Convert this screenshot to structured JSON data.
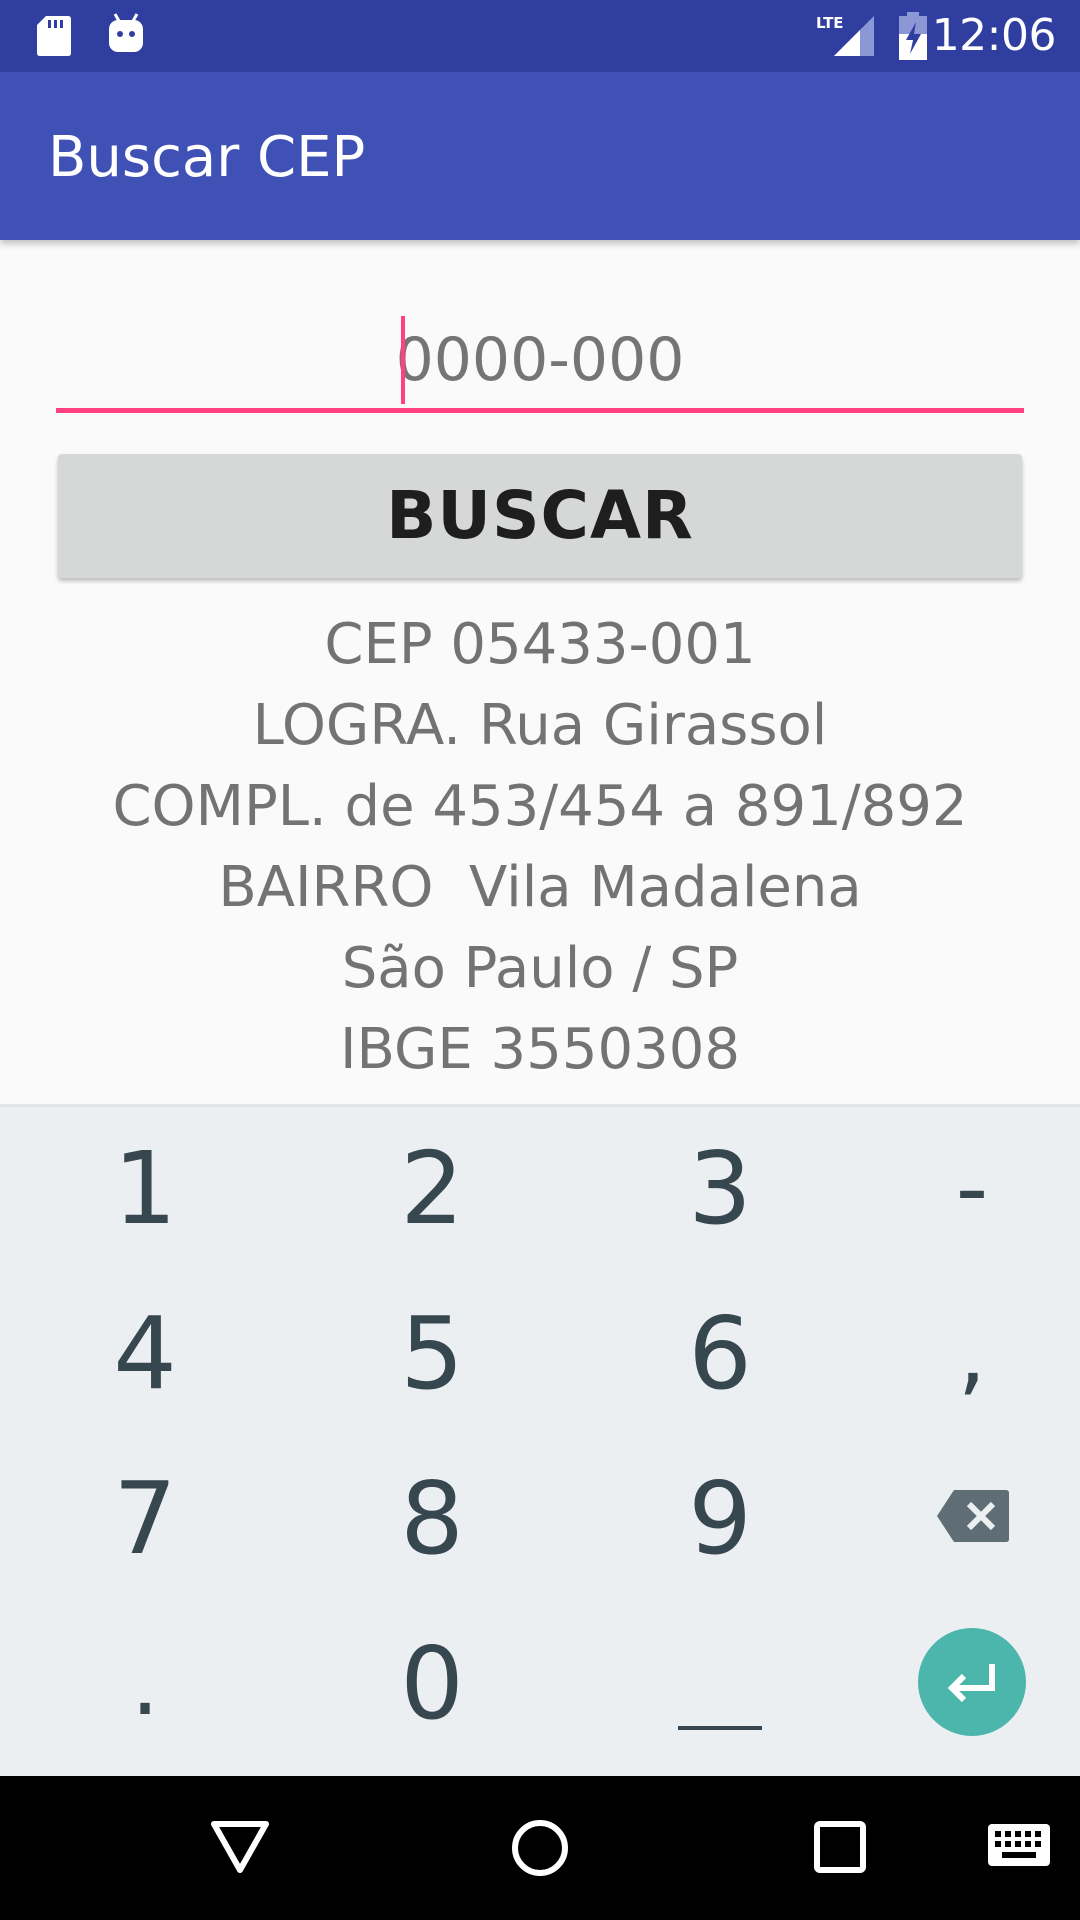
{
  "status_bar": {
    "time": "12:06",
    "network": "LTE",
    "icons": [
      "sd-card-icon",
      "android-icon",
      "lte-signal-icon",
      "battery-charging-icon"
    ]
  },
  "app_bar": {
    "title": "Buscar CEP",
    "color": "#3f51b5"
  },
  "form": {
    "cep_placeholder": "0000-000",
    "cep_value": "",
    "accent_color": "#ff4081",
    "search_button_label": "BUSCAR"
  },
  "result": {
    "cep": "CEP 05433-001",
    "logradouro": "LOGRA. Rua Girassol",
    "complemento": "COMPL. de 453/454 a 891/892",
    "bairro": "BAIRRO  Vila Madalena",
    "cidade_uf": "São Paulo / SP",
    "ibge": "IBGE 3550308"
  },
  "keyboard": {
    "keys": [
      "1",
      "2",
      "3",
      "-",
      "4",
      "5",
      "6",
      ",",
      "7",
      "8",
      "9",
      "backspace",
      ".",
      "0",
      "space",
      "enter"
    ],
    "row1": [
      "1",
      "2",
      "3",
      "-"
    ],
    "row2": [
      "4",
      "5",
      "6",
      ","
    ],
    "row3": [
      "7",
      "8",
      "9"
    ],
    "row4": [
      ".",
      "0"
    ],
    "enter_color": "#4db6ac"
  },
  "nav_bar": {
    "buttons": [
      "back-icon",
      "home-icon",
      "recents-icon",
      "keyboard-switch-icon"
    ]
  }
}
